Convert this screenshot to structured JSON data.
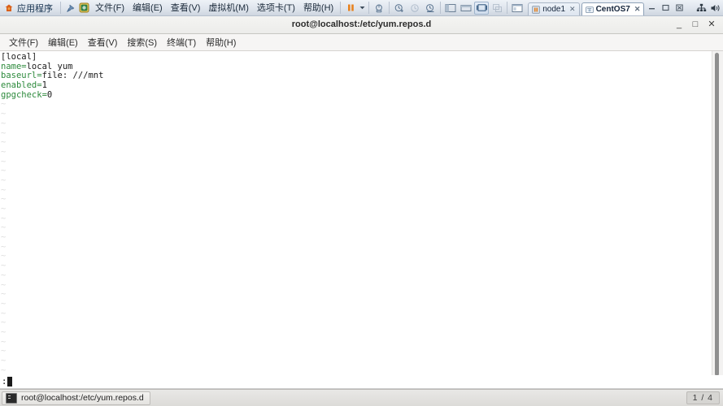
{
  "vmware": {
    "apps_menu_label": "应用程序",
    "apps_icon": "vmware-apps-icon",
    "pin_icon": "pin-icon",
    "home_icon": "home-library-icon",
    "menu": [
      {
        "label": "文件(F)",
        "name": "vm-menu-file"
      },
      {
        "label": "编辑(E)",
        "name": "vm-menu-edit"
      },
      {
        "label": "查看(V)",
        "name": "vm-menu-view"
      },
      {
        "label": "虚拟机(M)",
        "name": "vm-menu-vm"
      },
      {
        "label": "选项卡(T)",
        "name": "vm-menu-tabs"
      },
      {
        "label": "帮助(H)",
        "name": "vm-menu-help"
      }
    ],
    "toolbar": [
      {
        "name": "suspend-button",
        "icon": "pause-icon",
        "state": "normal"
      },
      {
        "name": "suspend-dropdown",
        "icon": "chevron-down-icon",
        "state": "normal"
      },
      {
        "name": "power-settings-button",
        "icon": "power-gear-icon",
        "state": "normal"
      },
      {
        "name": "snapshot-take-button",
        "icon": "snapshot-add-icon",
        "state": "normal"
      },
      {
        "name": "snapshot-revert-button",
        "icon": "snapshot-revert-icon",
        "state": "disabled"
      },
      {
        "name": "snapshot-manager-button",
        "icon": "snapshot-manager-icon",
        "state": "normal"
      },
      {
        "name": "show-sidebar-button",
        "icon": "sidebar-panel-icon",
        "state": "normal"
      },
      {
        "name": "show-thumbnail-bar-button",
        "icon": "thumbnail-bar-icon",
        "state": "normal"
      },
      {
        "name": "fullscreen-button",
        "icon": "fullscreen-icon",
        "state": "active"
      },
      {
        "name": "unity-mode-button",
        "icon": "unity-mode-icon",
        "state": "disabled"
      },
      {
        "name": "library-button",
        "icon": "library-icon",
        "state": "normal"
      }
    ],
    "tabs": [
      {
        "label": "node1",
        "active": false,
        "icon": "vm-suspended-icon",
        "close": "✕"
      },
      {
        "label": "CentOS7",
        "active": true,
        "icon": "vm-running-icon",
        "close": "✕"
      }
    ],
    "window_controls": [
      {
        "name": "vmware-minimize-button",
        "glyph": "—"
      },
      {
        "name": "vmware-maximize-button",
        "glyph": "❐"
      },
      {
        "name": "vmware-close-button",
        "glyph": "✕"
      }
    ],
    "tray": [
      {
        "name": "network-icon",
        "glyph": "network"
      },
      {
        "name": "volume-icon",
        "glyph": "volume"
      },
      {
        "name": "power-icon",
        "glyph": "power"
      }
    ]
  },
  "terminal": {
    "title": "root@localhost:/etc/yum.repos.d",
    "window_controls": [
      {
        "name": "terminal-minimize-button",
        "glyph": "_"
      },
      {
        "name": "terminal-maximize-button",
        "glyph": "□"
      },
      {
        "name": "terminal-close-button",
        "glyph": "✕"
      }
    ],
    "menu": [
      {
        "label": "文件(F)",
        "name": "terminal-menu-file"
      },
      {
        "label": "编辑(E)",
        "name": "terminal-menu-edit"
      },
      {
        "label": "查看(V)",
        "name": "terminal-menu-view"
      },
      {
        "label": "搜索(S)",
        "name": "terminal-menu-search"
      },
      {
        "label": "终端(T)",
        "name": "terminal-menu-terminal"
      },
      {
        "label": "帮助(H)",
        "name": "terminal-menu-help"
      }
    ]
  },
  "editor": {
    "lines": [
      {
        "key": "",
        "sep": "",
        "value": "[local]"
      },
      {
        "key": "name",
        "sep": "=",
        "value": "local yum"
      },
      {
        "key": "baseurl",
        "sep": "=",
        "value": "file: ///mnt"
      },
      {
        "key": "enabled",
        "sep": "=",
        "value": "1"
      },
      {
        "key": "gpgcheck",
        "sep": "=",
        "value": "0"
      }
    ],
    "empty_line_marker": "~",
    "empty_line_count": 29,
    "command_line": ":",
    "cursor": "block"
  },
  "guest_taskbar": {
    "items": [
      {
        "label": "root@localhost:/etc/yum.repos.d",
        "name": "taskbar-item-terminal",
        "icon": "terminal-icon"
      }
    ],
    "workspace_indicator": "1 / 4"
  },
  "colors": {
    "key_green": "#2e8b3d",
    "value_black": "#1b1b1b",
    "tilde_gray": "#dedede",
    "terminal_bg": "#ffffff",
    "vmware_chrome": "#dfe5ed",
    "accent_orange": "#e8821e"
  }
}
